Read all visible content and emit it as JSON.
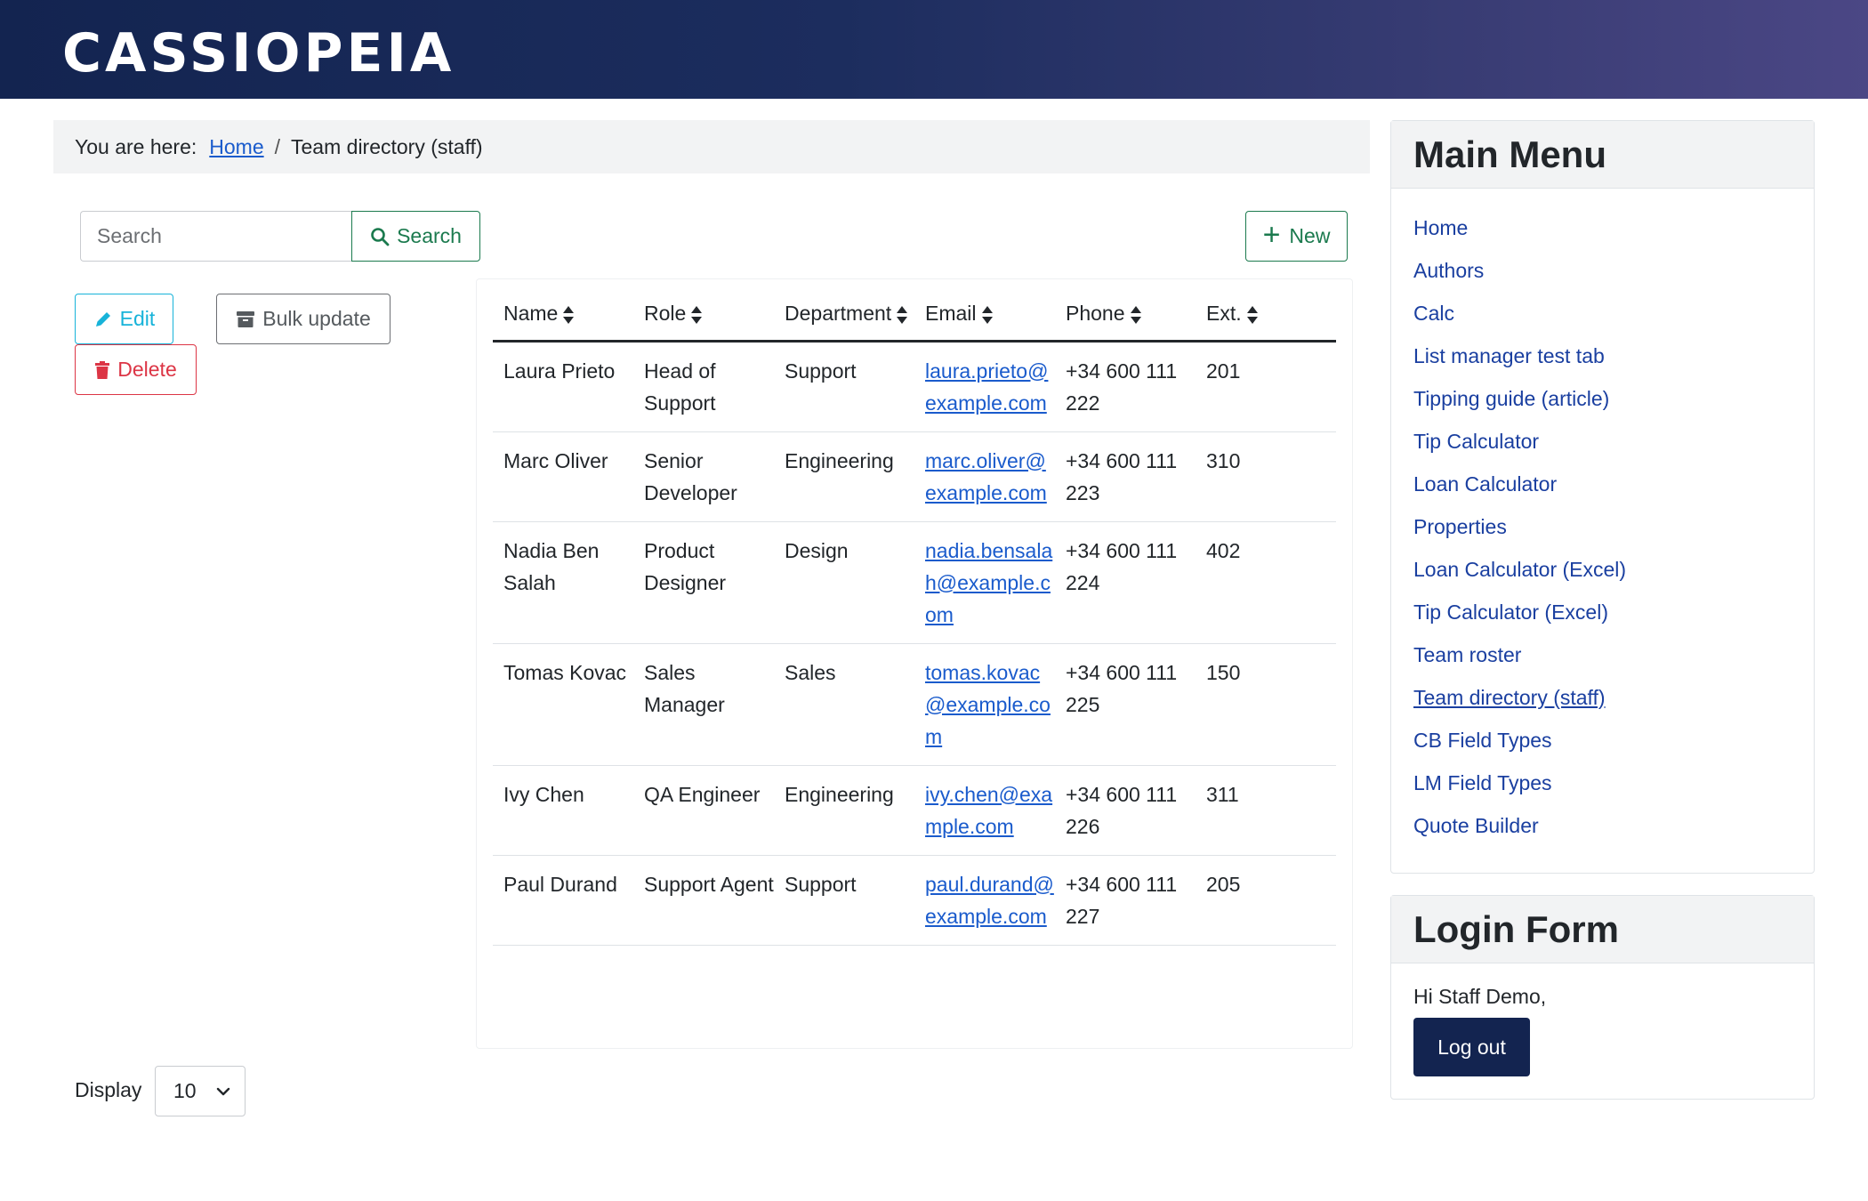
{
  "site": {
    "brand": "CASSIOPEIA"
  },
  "breadcrumb": {
    "prefix": "You are here:",
    "home": "Home",
    "separator": "/",
    "current": "Team directory (staff)"
  },
  "search": {
    "placeholder": "Search",
    "button_label": "Search"
  },
  "toolbar": {
    "new_label": "New",
    "edit_label": "Edit",
    "bulk_update_label": "Bulk update",
    "delete_label": "Delete"
  },
  "table": {
    "columns": [
      "Name",
      "Role",
      "Department",
      "Email",
      "Phone",
      "Ext."
    ],
    "rows": [
      [
        "Laura Prieto",
        "Head of Support",
        "Support",
        "laura.prieto@example.com",
        "+34 600 111 222",
        "201"
      ],
      [
        "Marc Oliver",
        "Senior Developer",
        "Engineering",
        "marc.oliver@example.com",
        "+34 600 111 223",
        "310"
      ],
      [
        "Nadia Ben Salah",
        "Product Designer",
        "Design",
        "nadia.bensalah@example.com",
        "+34 600 111 224",
        "402"
      ],
      [
        "Tomas Kovac",
        "Sales Manager",
        "Sales",
        "tomas.kovac@example.com",
        "+34 600 111 225",
        "150"
      ],
      [
        "Ivy Chen",
        "QA Engineer",
        "Engineering",
        "ivy.chen@example.com",
        "+34 600 111 226",
        "311"
      ],
      [
        "Paul Durand",
        "Support Agent",
        "Support",
        "paul.durand@example.com",
        "+34 600 111 227",
        "205"
      ]
    ]
  },
  "pagination": {
    "display_label": "Display",
    "limit": "10"
  },
  "main_menu": {
    "title": "Main Menu",
    "items": [
      "Home",
      "Authors",
      "Calc",
      "List manager test tab",
      "Tipping guide (article)",
      "Tip Calculator",
      "Loan Calculator",
      "Properties",
      "Loan Calculator (Excel)",
      "Tip Calculator (Excel)",
      "Team roster",
      "Team directory (staff)",
      "CB Field Types",
      "LM Field Types",
      "Quote Builder"
    ],
    "active_item": "Team directory (staff)"
  },
  "login_form": {
    "title": "Login Form",
    "greeting": "Hi Staff Demo,",
    "logout_label": "Log out"
  },
  "colors": {
    "header_start": "#132450",
    "header_end": "#4b4785",
    "success": "#1b7a4e",
    "info": "#17b3d9",
    "danger": "#dc3545",
    "link": "#1a5bcc",
    "primary_dark": "#132450"
  }
}
